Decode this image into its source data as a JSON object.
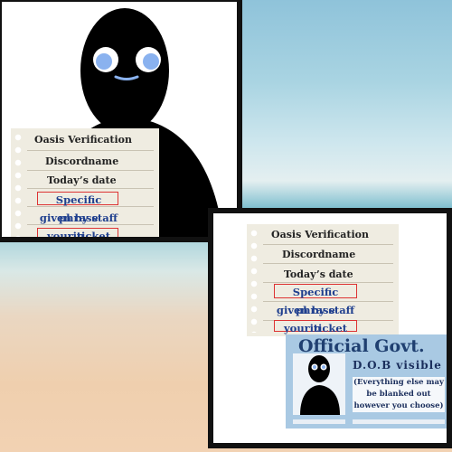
{
  "note": {
    "title": "Oasis Verification",
    "discord": "Discordname",
    "date": "Today’s date",
    "phrase_1": "Specific phrase",
    "phrase_2": "given by staff in",
    "phrase_3": "your ticket"
  },
  "id_card": {
    "title": "Official Govt. I.D.",
    "dob": "D.O.B visible",
    "note_1": "(Everything else may",
    "note_2": "be blanked out",
    "note_3": "however you choose)"
  },
  "colors": {
    "phrase_text": "#1f3f8e",
    "highlight_box": "#dd3333",
    "id_card_bg": "#a9c9e3",
    "eyes": "#8ab2ef"
  }
}
